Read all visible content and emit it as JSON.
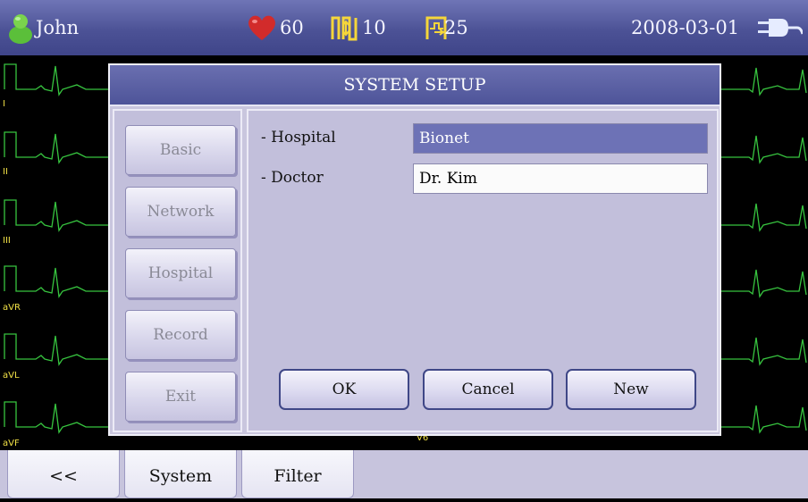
{
  "header": {
    "user_name": "John",
    "heart_rate": "60",
    "resp_rate": "10",
    "spo2": "25",
    "date": "2008-03-01",
    "icons": [
      "user-icon",
      "heart-icon",
      "respiration-icon",
      "spo2-icon",
      "plug-icon"
    ]
  },
  "ecg": {
    "leads": [
      "I",
      "II",
      "III",
      "aVR",
      "aVL",
      "aVF"
    ],
    "right_lead_label": "V6",
    "trace_color": "#37c43f",
    "label_color": "#f1e146"
  },
  "dialog": {
    "title": "SYSTEM SETUP",
    "sidebar": [
      "Basic",
      "Network",
      "Hospital",
      "Record",
      "Exit"
    ],
    "fields": [
      {
        "label": "- Hospital",
        "value": "Bionet"
      },
      {
        "label": "- Doctor",
        "value": "Dr. Kim"
      }
    ],
    "buttons": [
      "OK",
      "Cancel",
      "New"
    ]
  },
  "bottombar": {
    "tabs": [
      "<<",
      "System",
      "Filter"
    ]
  }
}
